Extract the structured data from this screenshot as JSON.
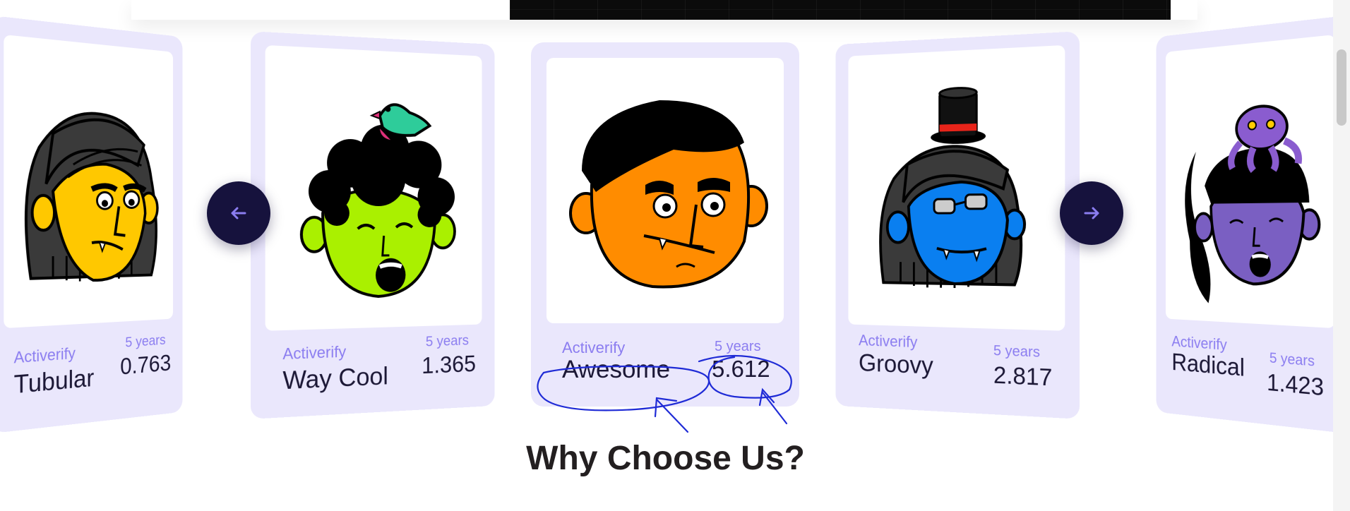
{
  "cards": [
    {
      "brand": "Activerify",
      "name": "Tubular",
      "years": "5 years",
      "value": "0.763"
    },
    {
      "brand": "Activerify",
      "name": "Way Cool",
      "years": "5 years",
      "value": "1.365"
    },
    {
      "brand": "Activerify",
      "name": "Awesome",
      "years": "5 years",
      "value": "5.612"
    },
    {
      "brand": "Activerify",
      "name": "Groovy",
      "years": "5 years",
      "value": "2.817"
    },
    {
      "brand": "Activerify",
      "name": "Radical",
      "years": "5 years",
      "value": "1.423"
    }
  ],
  "nav": {
    "prev_icon": "arrow-left-icon",
    "next_icon": "arrow-right-icon"
  },
  "section": {
    "title": "Why Choose Us?"
  },
  "colors": {
    "card_bg": "#eae7fc",
    "accent": "#8b7df0",
    "nav_bg": "#16123d",
    "annotation_ink": "#1f2bd6"
  }
}
